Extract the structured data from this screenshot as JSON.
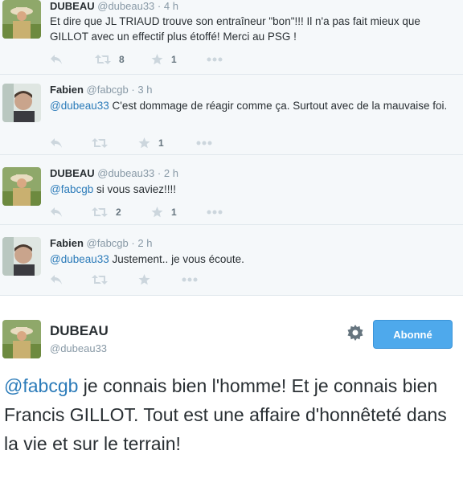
{
  "tweets": [
    {
      "name": "DUBEAU",
      "handle": "@dubeau33",
      "time": "4 h",
      "text": "Et dire que JL TRIAUD trouve son entraîneur \"bon\"!!! Il n'a pas fait mieux que GILLOT avec un effectif plus étoffé! Merci au PSG !",
      "mention": "",
      "retweets": "8",
      "favorites": "1"
    },
    {
      "name": "Fabien",
      "handle": "@fabcgb",
      "time": "3 h",
      "mention": "@dubeau33",
      "text": " C'est dommage de réagir comme ça. Surtout avec de la mauvaise foi.",
      "retweets": "",
      "favorites": "1"
    },
    {
      "name": "DUBEAU",
      "handle": "@dubeau33",
      "time": "2 h",
      "mention": "@fabcgb",
      "text": " si vous saviez!!!!",
      "retweets": "2",
      "favorites": "1"
    },
    {
      "name": "Fabien",
      "handle": "@fabcgb",
      "time": "2 h",
      "mention": "@dubeau33",
      "text": " Justement.. je vous écoute.",
      "retweets": "",
      "favorites": ""
    }
  ],
  "separator": "·",
  "main": {
    "name": "DUBEAU",
    "handle": "@dubeau33",
    "follow_label": "Abonné",
    "mention": "@fabcgb",
    "text": " je connais bien l'homme! Et je connais bien Francis GILLOT. Tout est une affaire d'honnêteté dans la vie et sur le terrain!"
  },
  "icons": {
    "reply": "reply-icon",
    "retweet": "retweet-icon",
    "favorite": "star-icon",
    "more": "more-icon",
    "settings": "gear-icon"
  },
  "colors": {
    "link": "#2b7bb9",
    "follow_button": "#4ea9ec",
    "icon": "#ccd6dd"
  }
}
